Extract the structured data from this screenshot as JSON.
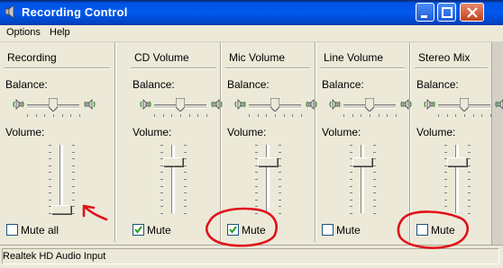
{
  "window": {
    "title": "Recording Control",
    "buttons": [
      "minimize-icon",
      "maximize-icon",
      "close-icon"
    ]
  },
  "menu": {
    "items": [
      "Options",
      "Help"
    ]
  },
  "labels": {
    "balance": "Balance:",
    "volume": "Volume:"
  },
  "panels": [
    {
      "title": "Recording",
      "mute_label": "Mute all",
      "mute_checked": false,
      "volume_level": 0.05,
      "balance_level": 0.5
    },
    {
      "title": "CD Volume",
      "mute_label": "Mute",
      "mute_checked": true,
      "volume_level": 0.75,
      "balance_level": 0.5
    },
    {
      "title": "Mic Volume",
      "mute_label": "Mute",
      "mute_checked": true,
      "volume_level": 0.75,
      "balance_level": 0.5
    },
    {
      "title": "Line Volume",
      "mute_label": "Mute",
      "mute_checked": false,
      "volume_level": 0.75,
      "balance_level": 0.5
    },
    {
      "title": "Stereo Mix",
      "mute_label": "Mute",
      "mute_checked": false,
      "volume_level": 0.75,
      "balance_level": 0.5
    }
  ],
  "status": {
    "text": "Realtek HD Audio Input"
  },
  "colors": {
    "titlebar": "#0054E3",
    "window_bg": "#ECE9D8",
    "annotation": "#E0101A",
    "speaker_wave": "#2E8B2E"
  }
}
